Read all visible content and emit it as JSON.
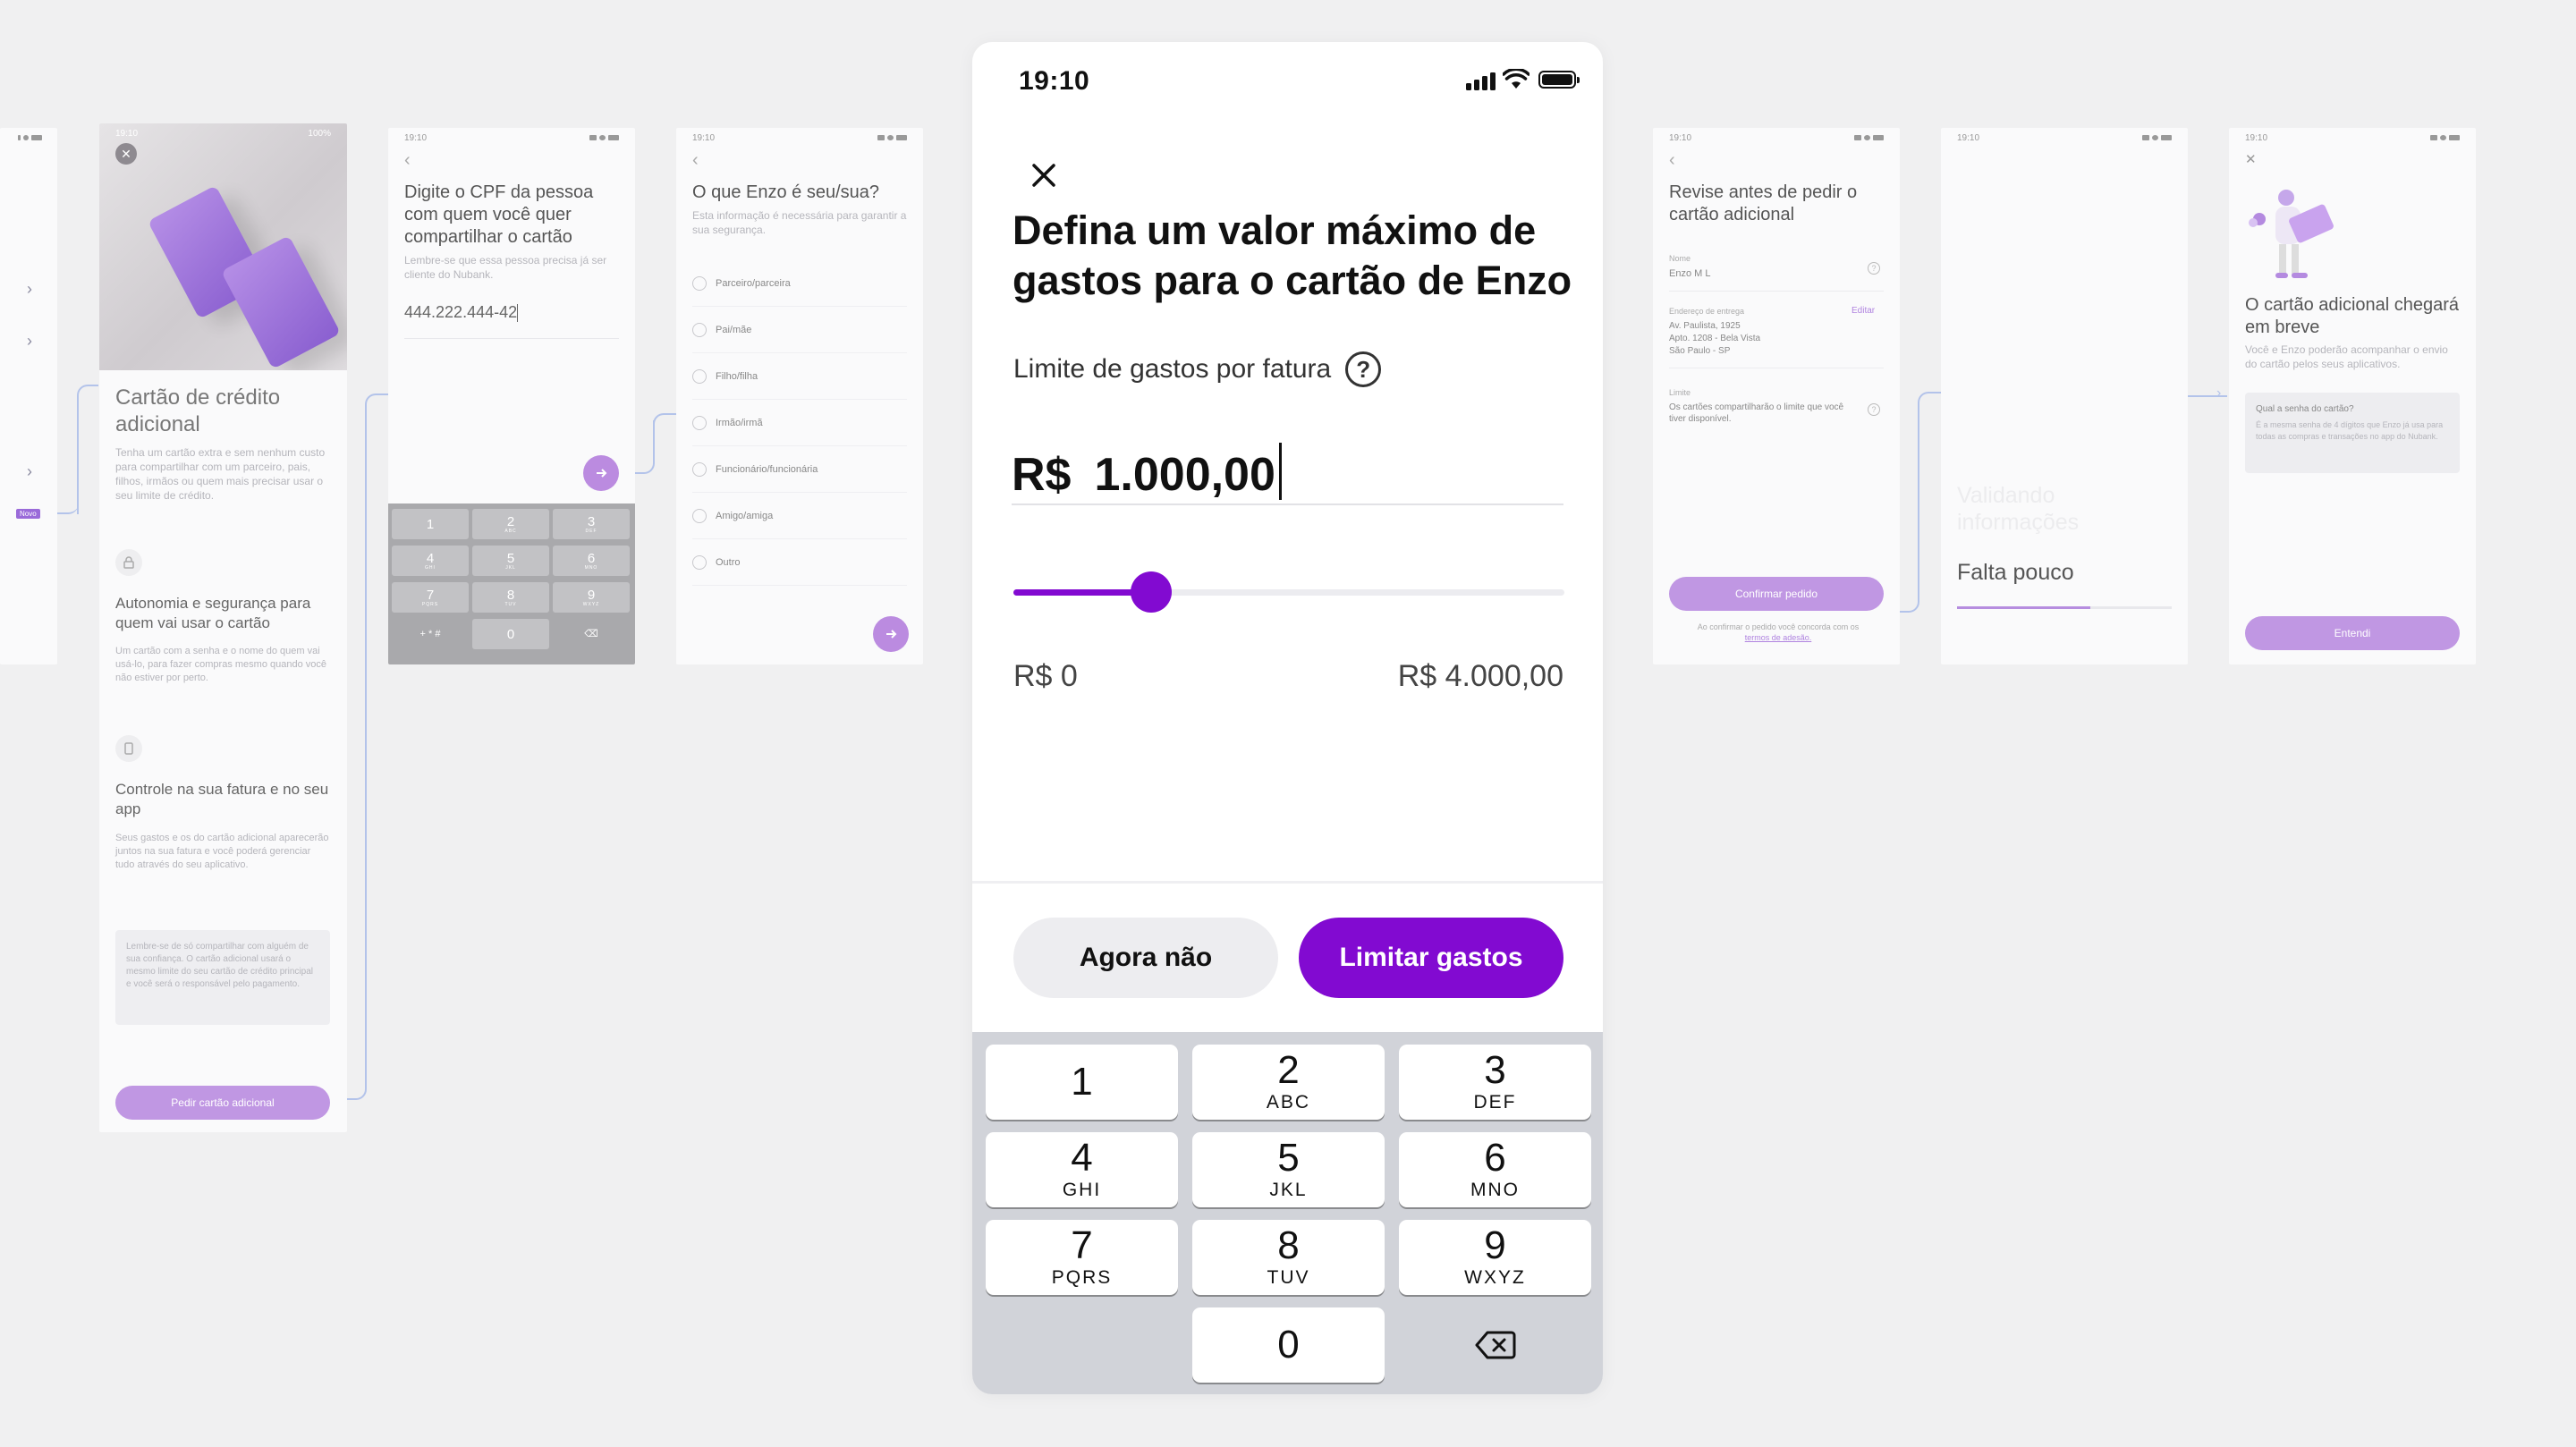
{
  "main": {
    "status_time": "19:10",
    "headline": "Defina um valor máximo de gastos para o cartão de Enzo",
    "limit_label": "Limite de gastos por fatura",
    "help_glyph": "?",
    "currency": "R$",
    "amount": "1.000,00",
    "slider": {
      "min_label": "R$ 0",
      "max_label": "R$ 4.000,00",
      "value": 1000,
      "min": 0,
      "max": 4000
    },
    "secondary_button": "Agora não",
    "primary_button": "Limitar gastos",
    "keypad": [
      {
        "digit": "1",
        "letters": ""
      },
      {
        "digit": "2",
        "letters": "ABC"
      },
      {
        "digit": "3",
        "letters": "DEF"
      },
      {
        "digit": "4",
        "letters": "GHI"
      },
      {
        "digit": "5",
        "letters": "JKL"
      },
      {
        "digit": "6",
        "letters": "MNO"
      },
      {
        "digit": "7",
        "letters": "PQRS"
      },
      {
        "digit": "8",
        "letters": "TUV"
      },
      {
        "digit": "9",
        "letters": "WXYZ"
      },
      {
        "digit": "",
        "letters": ""
      },
      {
        "digit": "0",
        "letters": ""
      },
      {
        "digit": "",
        "letters": ""
      }
    ],
    "accent_color": "#820ad1"
  },
  "screen0": {
    "badge": "Novo"
  },
  "screen1": {
    "status_time": "19:10",
    "status_battery": "100%",
    "title": "Cartão de crédito adicional",
    "intro": "Tenha um cartão extra e sem nenhum custo para compartilhar com um parceiro, pais, filhos, irmãos ou quem mais precisar usar o seu limite de crédito.",
    "feature1_title": "Autonomia e segurança para quem vai usar o cartão",
    "feature1_text": "Um cartão com a senha e o nome do quem vai usá-lo, para fazer compras mesmo quando você não estiver por perto.",
    "feature2_title": "Controle na sua fatura e no seu app",
    "feature2_text": "Seus gastos e os do cartão adicional aparecerão juntos na sua fatura e você poderá gerenciar tudo através do seu aplicativo.",
    "note": "Lembre-se de só compartilhar com alguém de sua confiança. O cartão adicional usará o mesmo limite do seu cartão de crédito principal e você será o responsável pelo pagamento.",
    "button": "Pedir cartão adicional"
  },
  "screen2": {
    "status_time": "19:10",
    "title": "Digite o CPF da pessoa com quem você quer compartilhar o cartão",
    "subtitle": "Lembre-se que essa pessoa precisa já ser cliente do Nubank.",
    "value": "444.222.444-42",
    "keys": [
      {
        "digit": "1",
        "letters": ""
      },
      {
        "digit": "2",
        "letters": "ABC"
      },
      {
        "digit": "3",
        "letters": "DEF"
      },
      {
        "digit": "4",
        "letters": "GHI"
      },
      {
        "digit": "5",
        "letters": "JKL"
      },
      {
        "digit": "6",
        "letters": "MNO"
      },
      {
        "digit": "7",
        "letters": "PQRS"
      },
      {
        "digit": "8",
        "letters": "TUV"
      },
      {
        "digit": "9",
        "letters": "WXYZ"
      },
      {
        "digit": "+ * #",
        "letters": ""
      },
      {
        "digit": "0",
        "letters": ""
      },
      {
        "digit": "⌫",
        "letters": ""
      }
    ]
  },
  "screen3": {
    "status_time": "19:10",
    "title": "O que Enzo é seu/sua?",
    "subtitle": "Esta informação é necessária para garantir a sua segurança.",
    "options": [
      "Parceiro/parceira",
      "Pai/mãe",
      "Filho/filha",
      "Irmão/irmã",
      "Funcionário/funcionária",
      "Amigo/amiga",
      "Outro"
    ]
  },
  "screen4": {
    "status_time": "19:10",
    "title": "Revise antes de pedir o cartão adicional",
    "name_label": "Nome",
    "name_value": "Enzo M L",
    "address_label": "Endereço de entrega",
    "edit_link": "Editar",
    "address_l1": "Av. Paulista, 1925",
    "address_l2": "Apto. 1208 - Bela Vista",
    "address_l3": "São Paulo - SP",
    "limit_label": "Limite",
    "limit_value": "Os cartões compartilharão o limite que você tiver disponível.",
    "button": "Confirmar pedido",
    "terms_prefix": "Ao confirmar o pedido você concorda com os ",
    "terms_link": "termos de adesão."
  },
  "screen5": {
    "status_time": "19:10",
    "faded_text": "Validando informações",
    "text": "Falta pouco",
    "progress": 0.62
  },
  "screen6": {
    "status_time": "19:10",
    "title": "O cartão adicional chegará em breve",
    "subtitle": "Você e Enzo poderão acompanhar o envio do cartão pelos seus aplicativos.",
    "card_title": "Qual a senha do cartão?",
    "card_text": "É a mesma senha de 4 dígitos que Enzo já usa para todas as compras e transações no app do Nubank.",
    "button": "Entendi"
  }
}
